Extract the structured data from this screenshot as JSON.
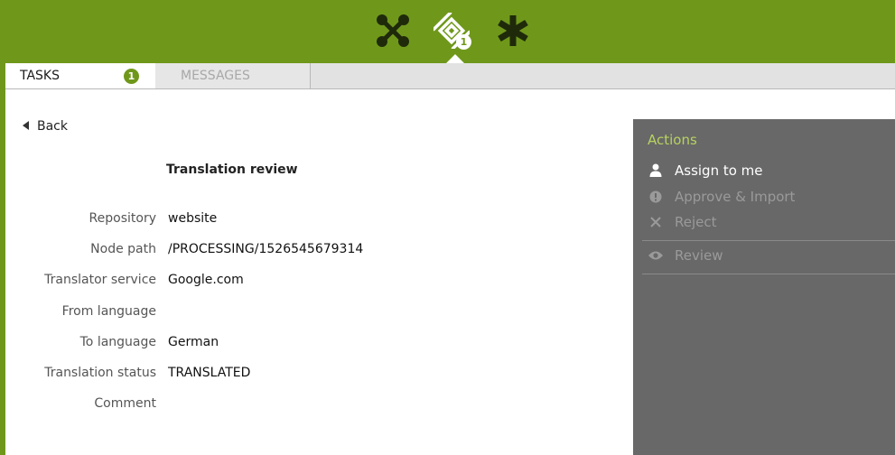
{
  "topbar": {
    "icons": [
      {
        "name": "workflow-icon"
      },
      {
        "name": "translation-tasks-icon"
      },
      {
        "name": "asterisk-icon"
      }
    ],
    "badge": "1",
    "color": "#6f981b"
  },
  "tabs": {
    "tasks": {
      "label": "TASKS",
      "count": "1"
    },
    "messages": {
      "label": "MESSAGES"
    }
  },
  "main": {
    "back_label": "Back",
    "title": "Translation review",
    "fields": [
      {
        "label": "Repository",
        "value": "website"
      },
      {
        "label": "Node path",
        "value": "/PROCESSING/1526545679314"
      },
      {
        "label": "Translator service",
        "value": "Google.com"
      },
      {
        "label": "From language",
        "value": ""
      },
      {
        "label": "To language",
        "value": "German"
      },
      {
        "label": "Translation status",
        "value": "TRANSLATED"
      },
      {
        "label": "Comment",
        "value": ""
      }
    ]
  },
  "actions": {
    "heading": "Actions",
    "items": [
      {
        "label": "Assign to me",
        "icon": "user-icon",
        "enabled": true
      },
      {
        "label": "Approve & Import",
        "icon": "info-icon",
        "enabled": false
      },
      {
        "label": "Reject",
        "icon": "close-icon",
        "enabled": false
      },
      {
        "label": "Review",
        "icon": "eye-icon",
        "enabled": false
      }
    ]
  }
}
